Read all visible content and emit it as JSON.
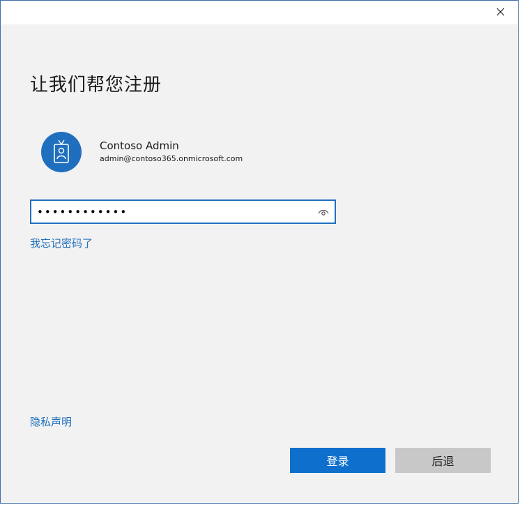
{
  "window": {
    "close_label": "✕"
  },
  "page": {
    "title": "让我们帮您注册"
  },
  "account": {
    "name": "Contoso Admin",
    "email": "admin@contoso365.onmicrosoft.com",
    "avatar_icon": "id-badge-icon"
  },
  "password": {
    "value": "••••••••••••",
    "reveal_icon": "eye-icon"
  },
  "links": {
    "forgot_password": "我忘记密码了",
    "privacy": "隐私声明"
  },
  "buttons": {
    "sign_in": "登录",
    "back": "后退"
  },
  "colors": {
    "accent": "#1f6fbe",
    "primary_button": "#0f6fcd",
    "secondary_button": "#c8c8c8",
    "background": "#f2f2f2"
  }
}
